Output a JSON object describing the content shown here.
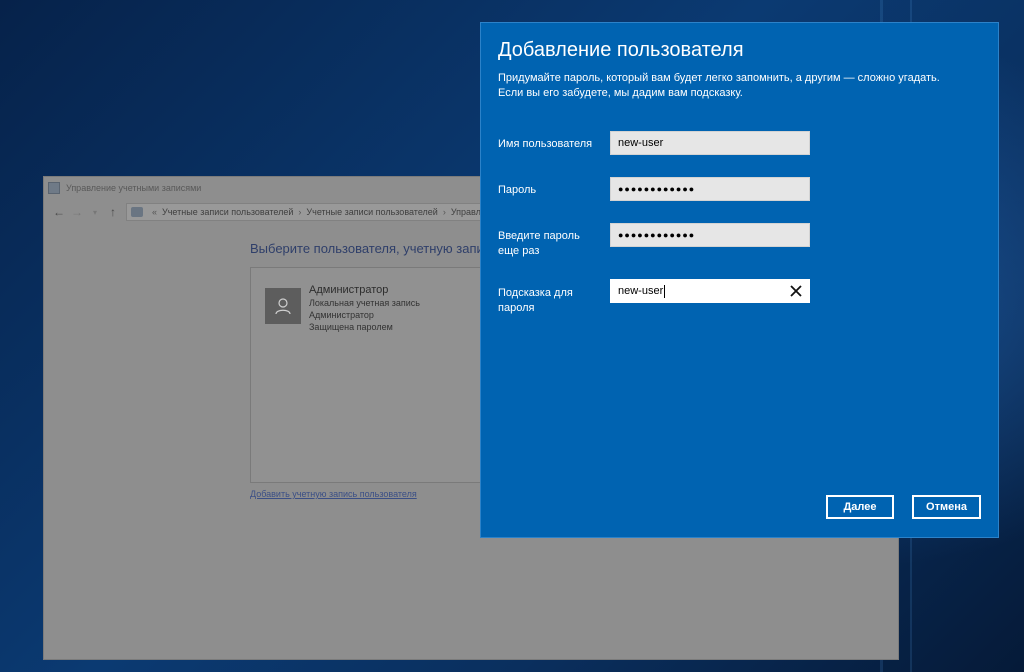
{
  "background_window": {
    "title": "Управление учетными записями",
    "breadcrumbs": [
      "Учетные записи пользователей",
      "Учетные записи пользователей",
      "Управл"
    ],
    "heading": "Выберите пользователя, учетную запись к",
    "user": {
      "name": "Администратор",
      "lines": [
        "Локальная учетная запись",
        "Администратор",
        "Защищена паролем"
      ]
    },
    "add_link": "Добавить учетную запись пользователя"
  },
  "dialog": {
    "title": "Добавление пользователя",
    "description_1": "Придумайте пароль, который вам будет легко запомнить, а другим — сложно угадать.",
    "description_2": "Если вы его забудете, мы дадим вам подсказку.",
    "fields": {
      "username": {
        "label": "Имя пользователя",
        "value": "new-user"
      },
      "password": {
        "label": "Пароль",
        "value": "●●●●●●●●●●●●"
      },
      "password_confirm": {
        "label_1": "Введите пароль",
        "label_2": "еще раз",
        "value": "●●●●●●●●●●●●"
      },
      "hint": {
        "label_1": "Подсказка для",
        "label_2": "пароля",
        "value": "new-user"
      }
    },
    "buttons": {
      "next": "Далее",
      "cancel": "Отмена"
    },
    "colors": {
      "accent": "#0063b1",
      "text": "#ffffff"
    }
  },
  "icons": [
    "back-arrow-icon",
    "forward-arrow-icon",
    "up-arrow-icon",
    "user-accounts-icon",
    "user-avatar-icon",
    "clear-icon"
  ]
}
